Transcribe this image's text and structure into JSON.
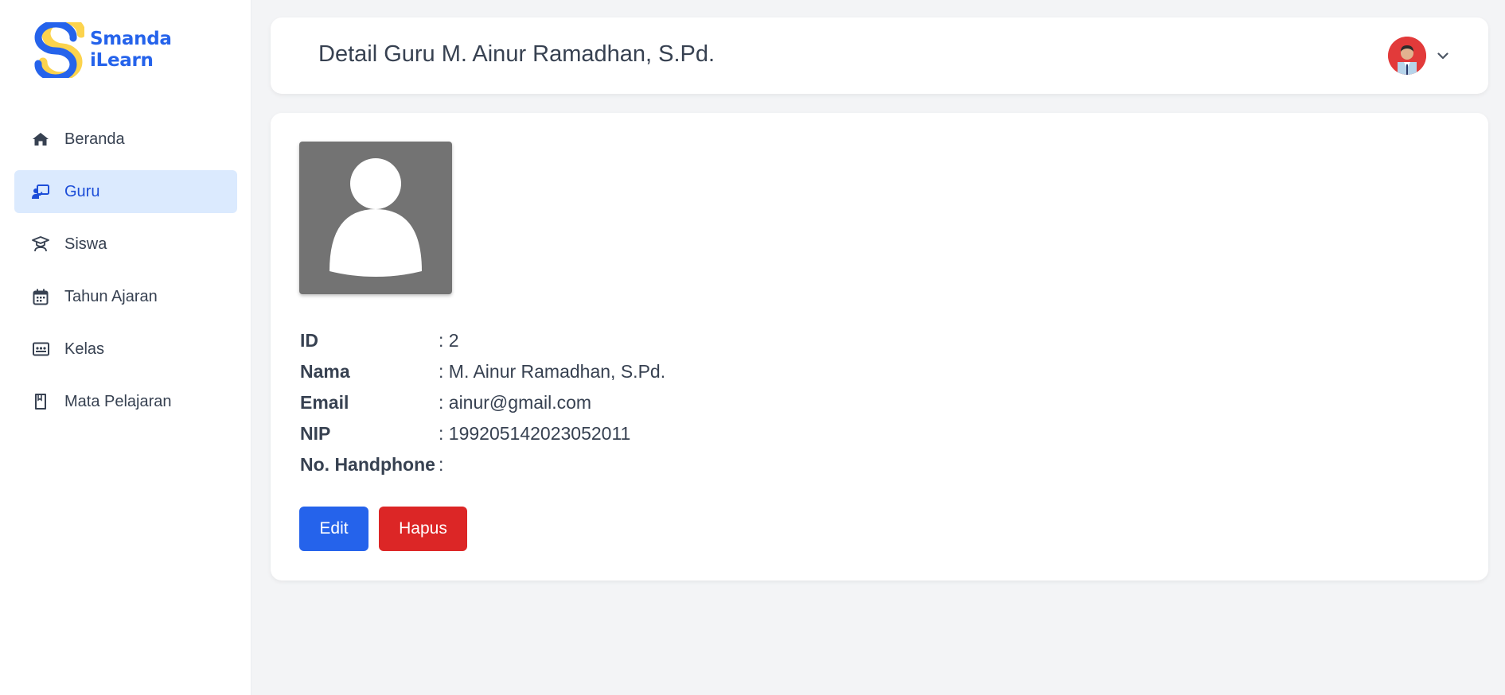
{
  "brand": {
    "line1": "Smanda",
    "line2": "iLearn",
    "primary_color": "#2563eb",
    "accent_color": "#fcd34d"
  },
  "sidebar": {
    "items": [
      {
        "label": "Beranda",
        "icon": "home-icon",
        "active": false
      },
      {
        "label": "Guru",
        "icon": "teacher-icon",
        "active": true
      },
      {
        "label": "Siswa",
        "icon": "student-icon",
        "active": false
      },
      {
        "label": "Tahun Ajaran",
        "icon": "calendar-icon",
        "active": false
      },
      {
        "label": "Kelas",
        "icon": "classroom-icon",
        "active": false
      },
      {
        "label": "Mata Pelajaran",
        "icon": "book-icon",
        "active": false
      }
    ]
  },
  "header": {
    "title": "Detail Guru M. Ainur Ramadhan, S.Pd.",
    "user_avatar": "user-avatar",
    "menu_icon": "chevron-down-icon"
  },
  "detail": {
    "photo": "person-placeholder-icon",
    "fields": [
      {
        "label": "ID",
        "value": ": 2"
      },
      {
        "label": "Nama",
        "value": ": M. Ainur Ramadhan, S.Pd."
      },
      {
        "label": "Email",
        "value": ": ainur@gmail.com"
      },
      {
        "label": "NIP",
        "value": ": 199205142023052011"
      },
      {
        "label": "No. Handphone",
        "value": ":"
      }
    ]
  },
  "actions": {
    "edit_label": "Edit",
    "delete_label": "Hapus",
    "edit_color": "#2563eb",
    "delete_color": "#dc2626"
  }
}
